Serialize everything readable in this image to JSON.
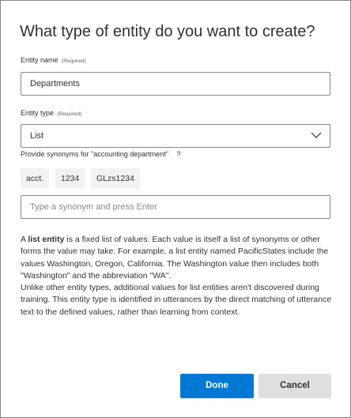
{
  "dialog": {
    "title": "What type of entity do you want to create?"
  },
  "entity_name": {
    "label": "Entity name",
    "required_label": "(Required)",
    "value": "Departments"
  },
  "entity_type": {
    "label": "Entity type",
    "required_label": "(Required)",
    "selected": "List",
    "icon": "chevron-down-icon"
  },
  "synonyms": {
    "hint": "Provide synonyms for \"accounting department\"",
    "help": "?",
    "chips": [
      "acct.",
      "1234",
      "GLzs1234"
    ],
    "placeholder": "Type a synonym and press Enter"
  },
  "description": {
    "para1_prefix": "A ",
    "para1_bold": "list entity",
    "para1_rest": " is a fixed list of values. Each value is itself a list of synonyms or other forms the value may take. For example, a list entity named PacificStates include the values Washington, Oregon, California. The Washington value then includes both \"Washington\" and the abbreviation \"WA\".",
    "para2": "Unlike other entity types, additional values for list entities aren't discovered during training. This entity type is identified in utterances by the direct matching of utterance text to the defined values, rather than learning from context."
  },
  "buttons": {
    "done": "Done",
    "cancel": "Cancel"
  },
  "colors": {
    "primary": "#0078d4",
    "secondary_bg": "#e1dfdd",
    "chip_bg": "#f3f2f1",
    "border": "#8a8886"
  }
}
